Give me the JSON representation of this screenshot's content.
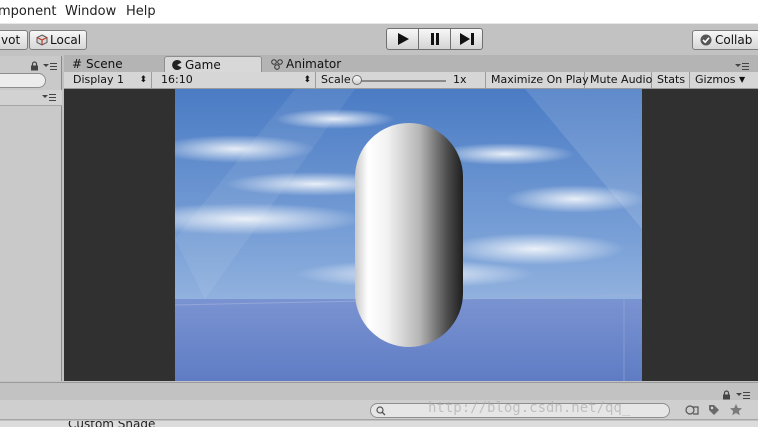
{
  "menu": {
    "items": [
      "mponent",
      "Window",
      "Help"
    ]
  },
  "toolbar": {
    "pivot_label": "vot",
    "local_label": "Local",
    "collab_label": "Collab"
  },
  "tabs": {
    "scene": "Scene",
    "game": "Game",
    "animator": "Animator"
  },
  "game_toolbar": {
    "display": "Display 1",
    "aspect": "16:10",
    "scale_label": "Scale",
    "scale_value": "1x",
    "scale_level": 0.0,
    "maximize": "Maximize On Play",
    "mute": "Mute Audio",
    "stats": "Stats",
    "gizmos": "Gizmos"
  },
  "bottom": {
    "watermark": "http://blog.csdn.net/qq_",
    "partial_text": "Custom Shade"
  },
  "colors": {
    "sky_top": "#4f7fc6",
    "sky_bottom": "#a8c2e4",
    "ground": "#6b85c9",
    "letterbox": "#303030"
  },
  "icons": [
    "lock-icon",
    "menu-icon",
    "local-cube-icon",
    "scene-grid-icon",
    "game-pacman-icon",
    "animator-icon",
    "play-icon",
    "pause-icon",
    "step-icon",
    "check-icon",
    "search-icon",
    "tag-icon",
    "star-icon"
  ]
}
